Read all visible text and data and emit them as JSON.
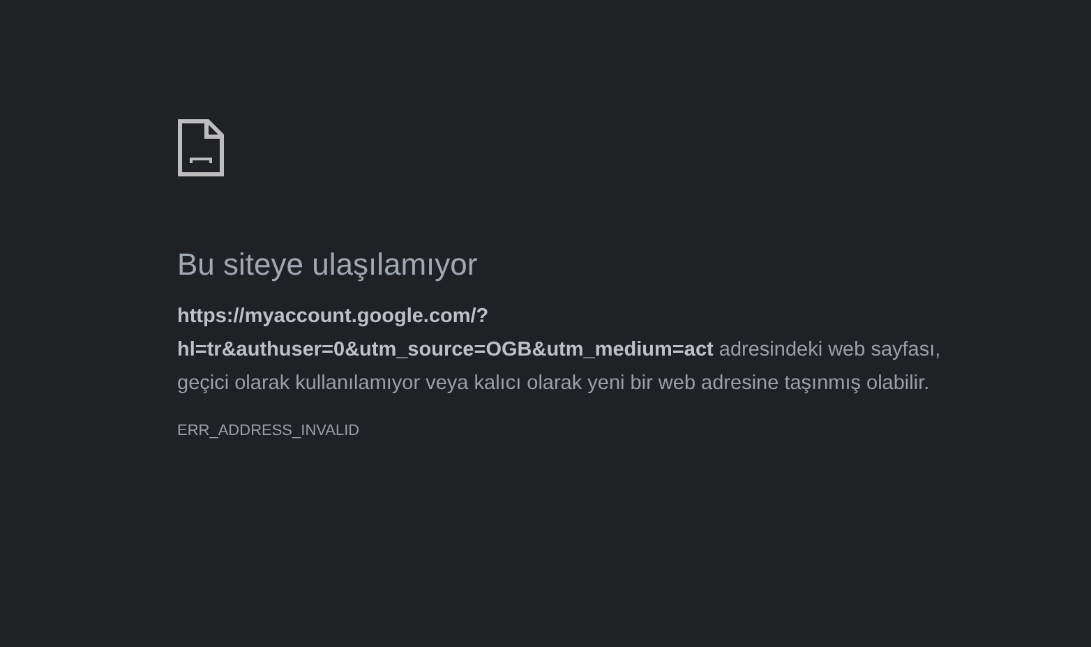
{
  "title": "Bu siteye ulaşılamıyor",
  "message": "**https://myaccount.google.com/?hl=tr&authuser=0&utm_source=OGB&utm_medium=act** adresindeki web sayfası, geçici olarak kullanılamıyor veya kalıcı olarak yeni bir web adresine taşınmış olabilir.",
  "error_code": "ERR_ADDRESS_INVALID"
}
